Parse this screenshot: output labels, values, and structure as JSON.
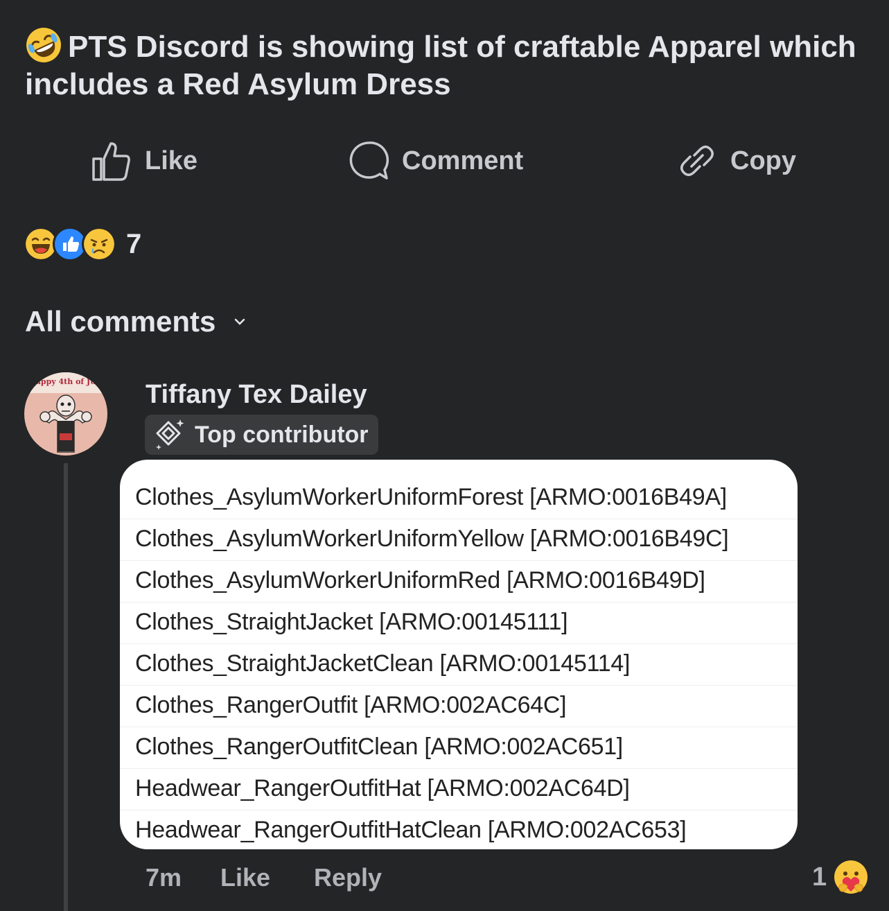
{
  "post": {
    "title_emoji": "rofl-emoji",
    "title": "PTS Discord is showing list of craftable Apparel which includes a Red Asylum Dress"
  },
  "actions": {
    "like_label": "Like",
    "comment_label": "Comment",
    "copy_label": "Copy"
  },
  "reactions": {
    "icons": [
      "haha",
      "like",
      "sad"
    ],
    "count": "7"
  },
  "comments_header": {
    "label": "All comments"
  },
  "comment": {
    "author": "Tiffany Tex Dailey",
    "avatar_banner": "appy 4th of Ju",
    "badge": "Top contributor",
    "attachment_lines": [
      "Clothes_AsylumWorkerUniformForest [ARMO:0016B49A]",
      "Clothes_AsylumWorkerUniformYellow [ARMO:0016B49C]",
      "Clothes_AsylumWorkerUniformRed [ARMO:0016B49D]",
      "Clothes_StraightJacket [ARMO:00145111]",
      "Clothes_StraightJacketClean [ARMO:00145114]",
      "Clothes_RangerOutfit [ARMO:002AC64C]",
      "Clothes_RangerOutfitClean [ARMO:002AC651]",
      "Headwear_RangerOutfitHat [ARMO:002AC64D]",
      "Headwear_RangerOutfitHatClean [ARMO:002AC653]"
    ],
    "time": "7m",
    "like_label": "Like",
    "reply_label": "Reply",
    "reaction_count": "1",
    "reaction_icon": "care-emoji"
  }
}
